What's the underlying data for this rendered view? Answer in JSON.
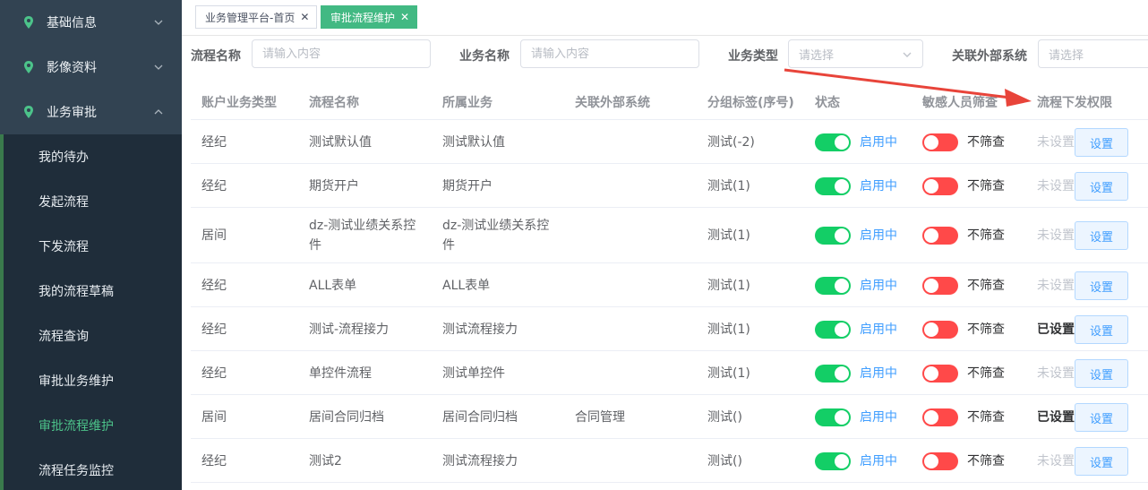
{
  "sidebar": {
    "parents": [
      {
        "label": "基础信息",
        "icon": "location-pin-icon",
        "expanded": false
      },
      {
        "label": "影像资料",
        "icon": "location-pin-icon",
        "expanded": false
      },
      {
        "label": "业务审批",
        "icon": "location-pin-icon",
        "expanded": true
      }
    ],
    "children": [
      {
        "label": "我的待办",
        "active": false
      },
      {
        "label": "发起流程",
        "active": false
      },
      {
        "label": "下发流程",
        "active": false
      },
      {
        "label": "我的流程草稿",
        "active": false
      },
      {
        "label": "流程查询",
        "active": false
      },
      {
        "label": "审批业务维护",
        "active": false
      },
      {
        "label": "审批流程维护",
        "active": true
      },
      {
        "label": "流程任务监控",
        "active": false
      }
    ]
  },
  "tabs": [
    {
      "label": "业务管理平台-首页",
      "active": false
    },
    {
      "label": "审批流程维护",
      "active": true
    }
  ],
  "filter": {
    "process_name_label": "流程名称",
    "process_name_placeholder": "请输入内容",
    "business_name_label": "业务名称",
    "business_name_placeholder": "请输入内容",
    "business_type_label": "业务类型",
    "business_type_placeholder": "请选择",
    "external_system_label": "关联外部系统",
    "external_system_placeholder": "请选择"
  },
  "table": {
    "headers": [
      "账户业务类型",
      "流程名称",
      "所属业务",
      "关联外部系统",
      "分组标签(序号)",
      "状态",
      "敏感人员筛查",
      "流程下发权限"
    ],
    "status_on_label": "启用中",
    "screen_off_label": "不筛查",
    "set_button_label": "设置",
    "rows": [
      {
        "type": "经纪",
        "name": "测试默认值",
        "business": "测试默认值",
        "external": "",
        "group": "测试(-2)",
        "status_on": true,
        "screen_on": false,
        "perm": "未设置"
      },
      {
        "type": "经纪",
        "name": "期货开户",
        "business": "期货开户",
        "external": "",
        "group": "测试(1)",
        "status_on": true,
        "screen_on": false,
        "perm": "未设置"
      },
      {
        "type": "居间",
        "name": "dz-测试业绩关系控件",
        "business": "dz-测试业绩关系控件",
        "external": "",
        "group": "测试(1)",
        "status_on": true,
        "screen_on": false,
        "perm": "未设置"
      },
      {
        "type": "经纪",
        "name": "ALL表单",
        "business": "ALL表单",
        "external": "",
        "group": "测试(1)",
        "status_on": true,
        "screen_on": false,
        "perm": "未设置"
      },
      {
        "type": "经纪",
        "name": "测试-流程接力",
        "business": "测试流程接力",
        "external": "",
        "group": "测试(1)",
        "status_on": true,
        "screen_on": false,
        "perm": "已设置"
      },
      {
        "type": "经纪",
        "name": "单控件流程",
        "business": "测试单控件",
        "external": "",
        "group": "测试(1)",
        "status_on": true,
        "screen_on": false,
        "perm": "未设置"
      },
      {
        "type": "居间",
        "name": "居间合同归档",
        "business": "居间合同归档",
        "external": "合同管理",
        "group": "测试()",
        "status_on": true,
        "screen_on": false,
        "perm": "已设置"
      },
      {
        "type": "经纪",
        "name": "测试2",
        "business": "测试流程接力",
        "external": "",
        "group": "测试()",
        "status_on": true,
        "screen_on": false,
        "perm": "未设置"
      }
    ]
  },
  "colors": {
    "sidebar_bg": "#2b3a48",
    "active_menu": "#4cc38a",
    "tab_active": "#42b983",
    "switch_on": "#13ce66",
    "switch_off": "#ff4949",
    "link_blue": "#409eff",
    "annotation_arrow": "#e8443a"
  }
}
